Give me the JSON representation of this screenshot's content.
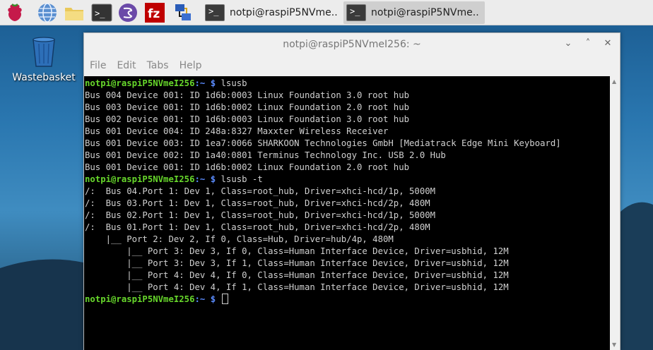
{
  "taskbar": {
    "tasks": [
      {
        "label": "notpi@raspiP5NVme..",
        "active": false
      },
      {
        "label": "notpi@raspiP5NVme..",
        "active": true
      }
    ]
  },
  "desktop": {
    "icons": [
      {
        "label": "Wastebasket",
        "icon": "wastebasket-icon"
      }
    ]
  },
  "window": {
    "title": "notpi@raspiP5NVmeI256: ~",
    "controls": [
      "⌄",
      "˄",
      "✕"
    ],
    "menu": [
      "File",
      "Edit",
      "Tabs",
      "Help"
    ]
  },
  "terminal": {
    "prompt_user": "notpi@raspiP5NVmeI256",
    "prompt_path": ":~ $",
    "lines": [
      {
        "type": "prompt",
        "cmd": " lsusb"
      },
      {
        "type": "out",
        "text": "Bus 004 Device 001: ID 1d6b:0003 Linux Foundation 3.0 root hub"
      },
      {
        "type": "out",
        "text": "Bus 003 Device 001: ID 1d6b:0002 Linux Foundation 2.0 root hub"
      },
      {
        "type": "out",
        "text": "Bus 002 Device 001: ID 1d6b:0003 Linux Foundation 3.0 root hub"
      },
      {
        "type": "out",
        "text": "Bus 001 Device 004: ID 248a:8327 Maxxter Wireless Receiver"
      },
      {
        "type": "out",
        "text": "Bus 001 Device 003: ID 1ea7:0066 SHARKOON Technologies GmbH [Mediatrack Edge Mini Keyboard]"
      },
      {
        "type": "out",
        "text": "Bus 001 Device 002: ID 1a40:0801 Terminus Technology Inc. USB 2.0 Hub"
      },
      {
        "type": "out",
        "text": "Bus 001 Device 001: ID 1d6b:0002 Linux Foundation 2.0 root hub"
      },
      {
        "type": "prompt",
        "cmd": " lsusb -t"
      },
      {
        "type": "out",
        "text": "/:  Bus 04.Port 1: Dev 1, Class=root_hub, Driver=xhci-hcd/1p, 5000M"
      },
      {
        "type": "out",
        "text": "/:  Bus 03.Port 1: Dev 1, Class=root_hub, Driver=xhci-hcd/2p, 480M"
      },
      {
        "type": "out",
        "text": "/:  Bus 02.Port 1: Dev 1, Class=root_hub, Driver=xhci-hcd/1p, 5000M"
      },
      {
        "type": "out",
        "text": "/:  Bus 01.Port 1: Dev 1, Class=root_hub, Driver=xhci-hcd/2p, 480M"
      },
      {
        "type": "out",
        "text": "    |__ Port 2: Dev 2, If 0, Class=Hub, Driver=hub/4p, 480M"
      },
      {
        "type": "out",
        "text": "        |__ Port 3: Dev 3, If 0, Class=Human Interface Device, Driver=usbhid, 12M"
      },
      {
        "type": "out",
        "text": "        |__ Port 3: Dev 3, If 1, Class=Human Interface Device, Driver=usbhid, 12M"
      },
      {
        "type": "out",
        "text": "        |__ Port 4: Dev 4, If 0, Class=Human Interface Device, Driver=usbhid, 12M"
      },
      {
        "type": "out",
        "text": "        |__ Port 4: Dev 4, If 1, Class=Human Interface Device, Driver=usbhid, 12M"
      },
      {
        "type": "prompt",
        "cmd": " ",
        "cursor": true
      }
    ]
  },
  "colors": {
    "prompt_user": "#67d72b",
    "prompt_path": "#5b8cff",
    "terminal_bg": "#000000",
    "terminal_fg": "#d0d0d0"
  }
}
